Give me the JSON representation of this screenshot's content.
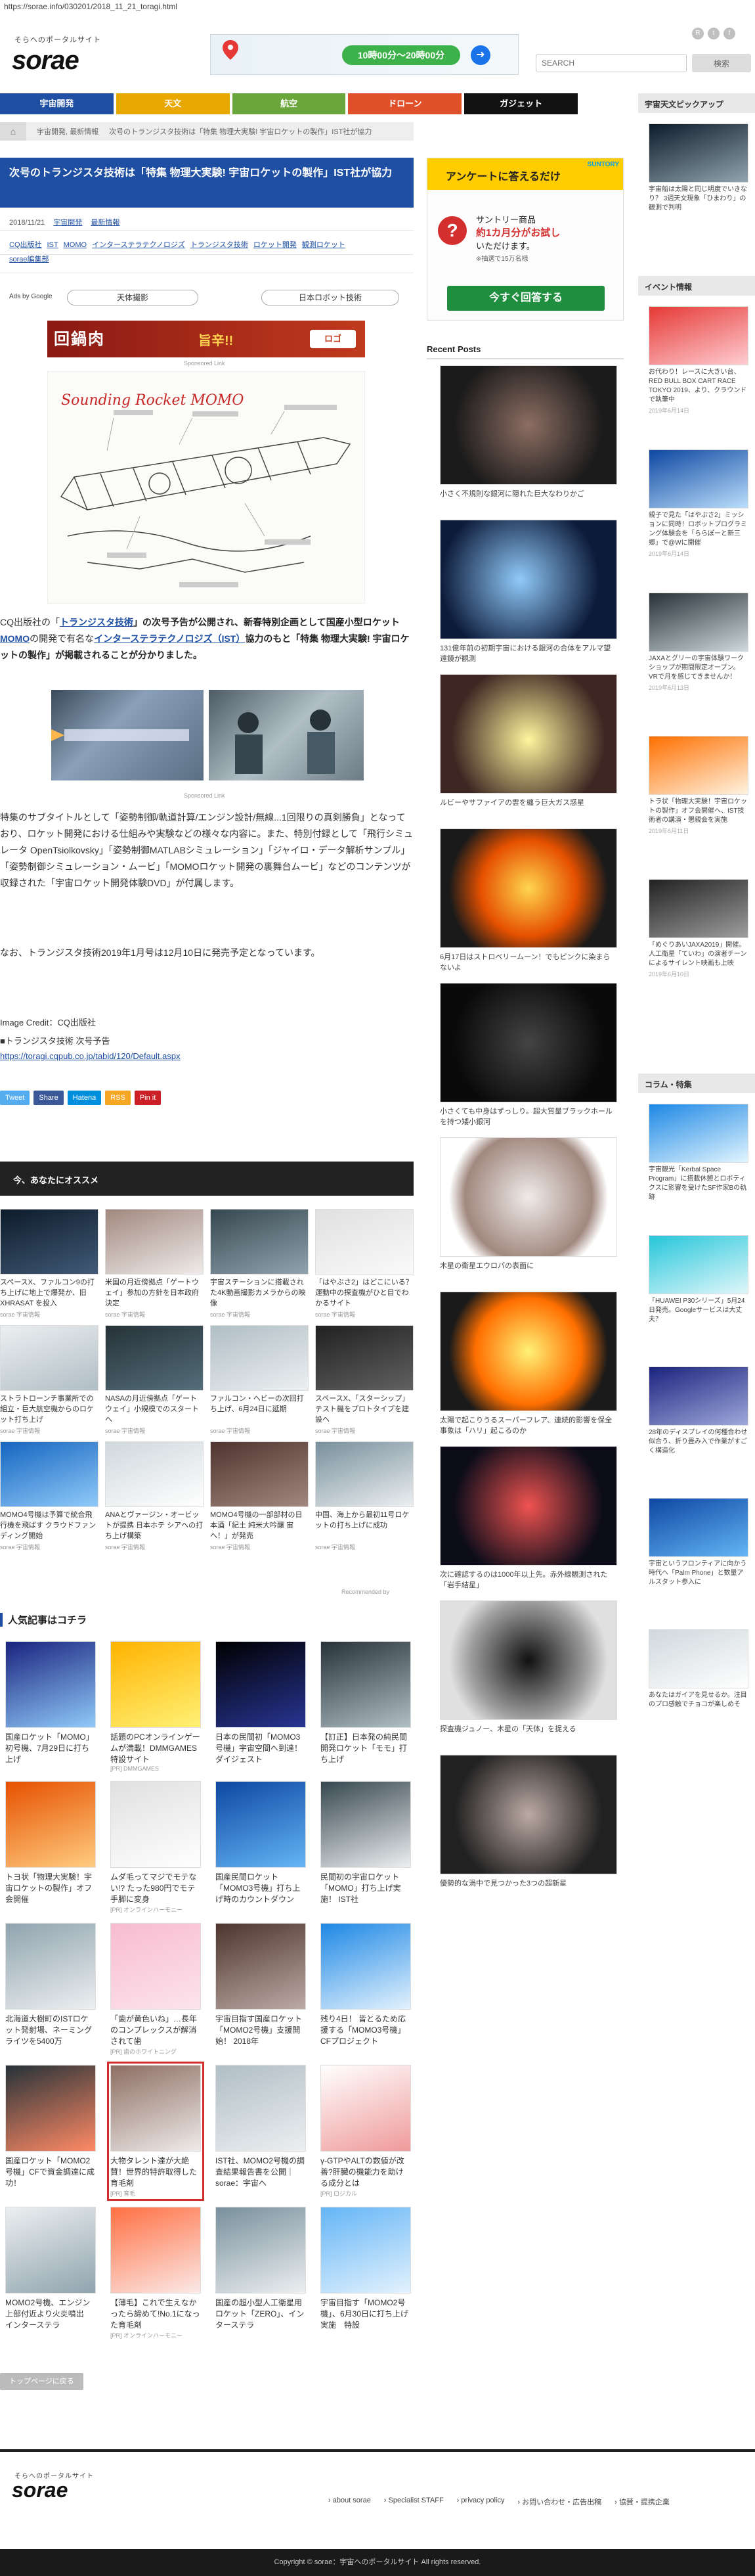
{
  "address": "https://sorae.info/030201/2018_11_21_toragi.html",
  "header": {
    "logo_sub": "そらへのポータルサイト",
    "logo": "sorae",
    "ad_pill": "10時00分〜20時00分",
    "search_placeholder": "SEARCH",
    "search_button": "検索"
  },
  "nav": [
    {
      "label": "宇宙開発",
      "color": "#1f4fa3"
    },
    {
      "label": "天文",
      "color": "#e8a800"
    },
    {
      "label": "航空",
      "color": "#6aa63b"
    },
    {
      "label": "ドローン",
      "color": "#e0512b"
    },
    {
      "label": "ガジェット",
      "color": "#111111"
    }
  ],
  "breadcrumb": [
    "宇宙開発, 最新情報",
    "次号のトランジスタ技術は「特集 物理大実験! 宇宙ロケットの製作」IST社が協力"
  ],
  "article": {
    "title": "次号のトランジスタ技術は「特集 物理大実験! 宇宙ロケットの製作」IST社が協力",
    "date": "2018/11/21",
    "category1": "宇宙開発",
    "category2": "最新情報",
    "tags": [
      "CQ出版社",
      "IST",
      "MOMO",
      "インターステラテクノロジズ",
      "トランジスタ技術",
      "ロケット開発",
      "観測ロケット"
    ],
    "tag_extra": "sorae編集部",
    "ads_by": "Ads by Google",
    "ad_pill_1": "天体撮影",
    "ad_pill_2": "日本ロボット技術",
    "banner_title": "回鍋肉",
    "banner_tag": "旨辛!!",
    "banner_logo": "ロゴ",
    "sponsored": "Sponsored Link",
    "illus_label": "Sounding Rocket MOMO",
    "p1_pre": "CQ出版社の「",
    "p1_link1": "トランジスタ技術",
    "p1_mid1": "」の次号予告が公開され、新春特別企画として国産小型ロケット",
    "p1_link2": "MOMO",
    "p1_mid2": "の開発で有名な",
    "p1_link3": "インターステラテクノロジズ（IST）",
    "p1_mid3": "協力のもと「特集 物理大実験! 宇宙ロケットの製作」が掲載されることが分かりました。",
    "p2": "特集のサブタイトルとして「姿勢制御/軌道計算/エンジン設計/無線...1回限りの真剣勝負」となっており、ロケット開発における仕組みや実験などの様々な内容に。また、特別付録として「飛行シミュレータ OpenTsiolkovsky」「姿勢制御MATLABシミュレーション」「ジャイロ・データ解析サンプル」「姿勢制御シミュレーション・ムービ」「MOMOロケット開発の裏舞台ムービ」などのコンテンツが収録された「宇宙ロケット開発体験DVD」が付属します。",
    "p3": "なお、トランジスタ技術2019年1月号は12月10日に発売予定となっています。",
    "credit": "Image Credit：CQ出版社",
    "credit2": "■トランジスタ技術 次号予告",
    "credit_link": "https://toragi.cqpub.co.jp/tabid/120/Default.aspx"
  },
  "share": [
    {
      "label": "Tweet",
      "color": "#55acee"
    },
    {
      "label": "Share",
      "color": "#3b5998"
    },
    {
      "label": "Hatena",
      "color": "#008fde"
    },
    {
      "label": "RSS",
      "color": "#f5a623"
    },
    {
      "label": "Pin it",
      "color": "#cb2027"
    }
  ],
  "recommend_header": "今、あなたにオススメ",
  "recommend": [
    {
      "cap": "スペースX、ファルコン9の打ち上げに地上で爆発か、旧XHRASAT を投入",
      "src": "sorae 宇宙情報"
    },
    {
      "cap": "米国の月近傍拠点「ゲートウェイ」参加の方針を日本政府決定",
      "src": "sorae 宇宙情報"
    },
    {
      "cap": "宇宙ステーションに搭載された4K動画撮影カメラからの映像",
      "src": "sorae 宇宙情報"
    },
    {
      "cap": "「はやぶさ2」はどこにいる？ 運動中の探査機がひと目でわかるサイト",
      "src": "sorae 宇宙情報"
    },
    {
      "cap": "ストラトローンチ事業所での組立・巨大航空機からのロケット打ち上げ",
      "src": "sorae 宇宙情報"
    },
    {
      "cap": "NASAの月近傍拠点「ゲートウェイ」小規模でのスタートへ",
      "src": "sorae 宇宙情報"
    },
    {
      "cap": "ファルコン・ヘビーの次回打ち上げ、6月24日に延期",
      "src": "sorae 宇宙情報"
    },
    {
      "cap": "スペースX、「スターシップ」テスト機をプロトタイプを建設へ",
      "src": "sorae 宇宙情報"
    },
    {
      "cap": "MOMO4号機は予算で統合飛行機を飛ばす クラウドファンディング開始",
      "src": "sorae 宇宙情報"
    },
    {
      "cap": "ANAとヴァージン・オービットが提携 日本ホテ シアへの打ち上げ構築",
      "src": "sorae 宇宙情報"
    },
    {
      "cap": "MOMO4号機の一部部材の日本酒「紀土 純米大吟醸 宙へ！」が発売",
      "src": "sorae 宇宙情報"
    },
    {
      "cap": "中国、海上から最初11号ロケットの打ち上げに成功",
      "src": "sorae 宇宙情報"
    }
  ],
  "recommended_by": "Recommended by",
  "popular_header": "人気記事はコチラ",
  "popular": [
    {
      "cap": "国産ロケット「MOMO」初号機、7月29日に打ち上げ",
      "src": "",
      "hl": false
    },
    {
      "cap": "話題のPCオンラインゲームが満載！DMMGAMES特設サイト",
      "src": "[PR] DMMGAMES",
      "hl": false
    },
    {
      "cap": "日本の民間初「MOMO3号機」宇宙空間へ到達！ダイジェスト",
      "src": "",
      "hl": false
    },
    {
      "cap": "【訂正】日本発の純民間開発ロケット「モモ」打ち上げ",
      "src": "",
      "hl": false
    },
    {
      "cap": "トヨ状「物理大実験！宇宙ロケットの製作」オフ会開催",
      "src": "",
      "hl": false
    },
    {
      "cap": "ムダ毛ってマジでモテない!? たった980円でモテ手脚に変身",
      "src": "[PR] オンラインハーモニー",
      "hl": false
    },
    {
      "cap": "国産民間ロケット「MOMO3号機」打ち上げ時のカウントダウン",
      "src": "",
      "hl": false
    },
    {
      "cap": "民間初の宇宙ロケット「MOMO」打ち上げ実施！ IST社",
      "src": "",
      "hl": false
    },
    {
      "cap": "北海道大樹町のISTロケット発射場、ネーミングライツを5400万",
      "src": "",
      "hl": false
    },
    {
      "cap": "「歯が黄色いね」…長年のコンプレックスが解消されて歯",
      "src": "[PR] 歯のホワイトニング",
      "hl": false
    },
    {
      "cap": "宇宙目指す国産ロケット「MOMO2号機」支援開始！ 2018年",
      "src": "",
      "hl": false
    },
    {
      "cap": "残り4日！ 皆とるため応援する「MOMO3号機」CFプロジェクト",
      "src": "",
      "hl": false
    },
    {
      "cap": "国産ロケット「MOMO2号機」CFで資金調達に成功！",
      "src": "",
      "hl": false
    },
    {
      "cap": "大物タレント達が大絶賛！世界的特許取得した育毛剤",
      "src": "[PR] 育毛",
      "hl": true
    },
    {
      "cap": "IST社、MOMO2号機の調査結果報告書を公開｜sorae：宇宙へ",
      "src": "",
      "hl": false
    },
    {
      "cap": "γ-GTPやALTの数値が改善?肝臓の機能力を助ける成分とは",
      "src": "[PR] ロジカル",
      "hl": false
    },
    {
      "cap": "MOMO2号機、エンジン上部付近より火炎噴出　インターステラ",
      "src": "",
      "hl": false
    },
    {
      "cap": "【薄毛】これで生えなかったら諦めて!No.1になった育毛剤",
      "src": "[PR] オンラインハーモニー",
      "hl": false
    },
    {
      "cap": "国産の超小型人工衛星用ロケット「ZERO」、インターステラ",
      "src": "",
      "hl": false
    },
    {
      "cap": "宇宙目指す「MOMO2号機」、6月30日に打ち上げ実施　特設",
      "src": "",
      "hl": false
    }
  ],
  "back_button": "トップページに戻る",
  "mid_ad": {
    "header": "アンケートに答えるだけ",
    "brand": "SUNTORY",
    "line1": "サントリー商品",
    "line2": "約1カ月分がお試し",
    "line3": "いただけます。",
    "line4": "※抽選で15万名様",
    "cta": "今すぐ回答する"
  },
  "recent_header": "Recent Posts",
  "recent": [
    {
      "cap": "小さく不規則な銀河に隠れた巨大なわりかご"
    },
    {
      "cap": "131億年前の初期宇宙における銀河の合体をアルマ望遠鏡が観測"
    },
    {
      "cap": "ルビーやサファイアの雲を纏う巨大ガス惑星"
    },
    {
      "cap": "6月17日はストロベリームーン！でもピンクに染まらないよ"
    },
    {
      "cap": "小さくても中身はずっしり。超大質量ブラックホールを持つ矮小銀河"
    },
    {
      "cap": "木星の衛星エウロパの表面に"
    },
    {
      "cap": "太陽で起こりうるスーパーフレア、連続的影響を保全事象は「ハリ」起こるのか"
    },
    {
      "cap": "次に確認するのは1000年以上先。赤外線観測された「岩手結星」"
    },
    {
      "cap": "探査機ジュノー、木星の「天体」を捉える"
    },
    {
      "cap": "優勢的な渦中で見つかった3つの超新星"
    }
  ],
  "side1_header": "宇宙天文ピックアップ",
  "side1": [
    {
      "cap": "宇宙船は太陽と同じ明度でいきなり？ 3週天文現象「ひまわり」の観測で判明",
      "date": ""
    }
  ],
  "side2_header": "イベント情報",
  "side2": [
    {
      "cap": "お代わり！レースに大きい台、RED BULL BOX CART RACE TOKYO 2019、より、クラウンドで執筆中",
      "date": "2019年6月14日"
    },
    {
      "cap": "親子で見た「はやぶさ2」ミッションに同時！ロボットプログラミング体験会を「ららぽーと新三郷」で@Wに開催",
      "date": "2019年6月14日"
    },
    {
      "cap": "JAXAとグリーの宇宙体験ワークショップが期間限定オープン。VRで月を感じてきませんか！",
      "date": "2019年6月13日"
    },
    {
      "cap": "トラ状「物理大実験！宇宙ロケットの製作」オフ会開催へ、IST技術者の講演・懇親会を実施",
      "date": "2019年6月11日"
    },
    {
      "cap": "「めぐりあいJAXA2019」開催。人工衛星「ていわ」の演者チーンによるサイレント映画も上映",
      "date": "2019年6月10日"
    }
  ],
  "side3_header": "コラム・特集",
  "side3": [
    {
      "cap": "宇宙観光「Kerbal Space Program」に搭載休憩とロボティクスに影響を受けたSF作家Bの軌跡",
      "date": ""
    },
    {
      "cap": "「HUAWEI P30シリーズ」5月24日発売。Googleサービスは大丈夫？",
      "date": ""
    },
    {
      "cap": "28年のディスプレイの何種合わせ似合う、折り畳み入で作業がすごく構造化",
      "date": ""
    },
    {
      "cap": "宇宙というフロンティアに向かう時代へ「Palm Phone」と数量アルスタット参入に",
      "date": ""
    },
    {
      "cap": "あなたはガイアを見せるか。注目のプロ感触でチョコが楽しめそ",
      "date": ""
    }
  ],
  "footer": {
    "logo_sub": "そらへのポータルサイト",
    "logo": "sorae",
    "links": [
      "› about sorae",
      "› Specialist STAFF",
      "› privacy policy",
      "› お問い合わせ・広告出稿",
      "› 協賛・提携企業"
    ],
    "copyright": "Copyright © sorae：宇宙へのポータルサイト All rights reserved."
  }
}
